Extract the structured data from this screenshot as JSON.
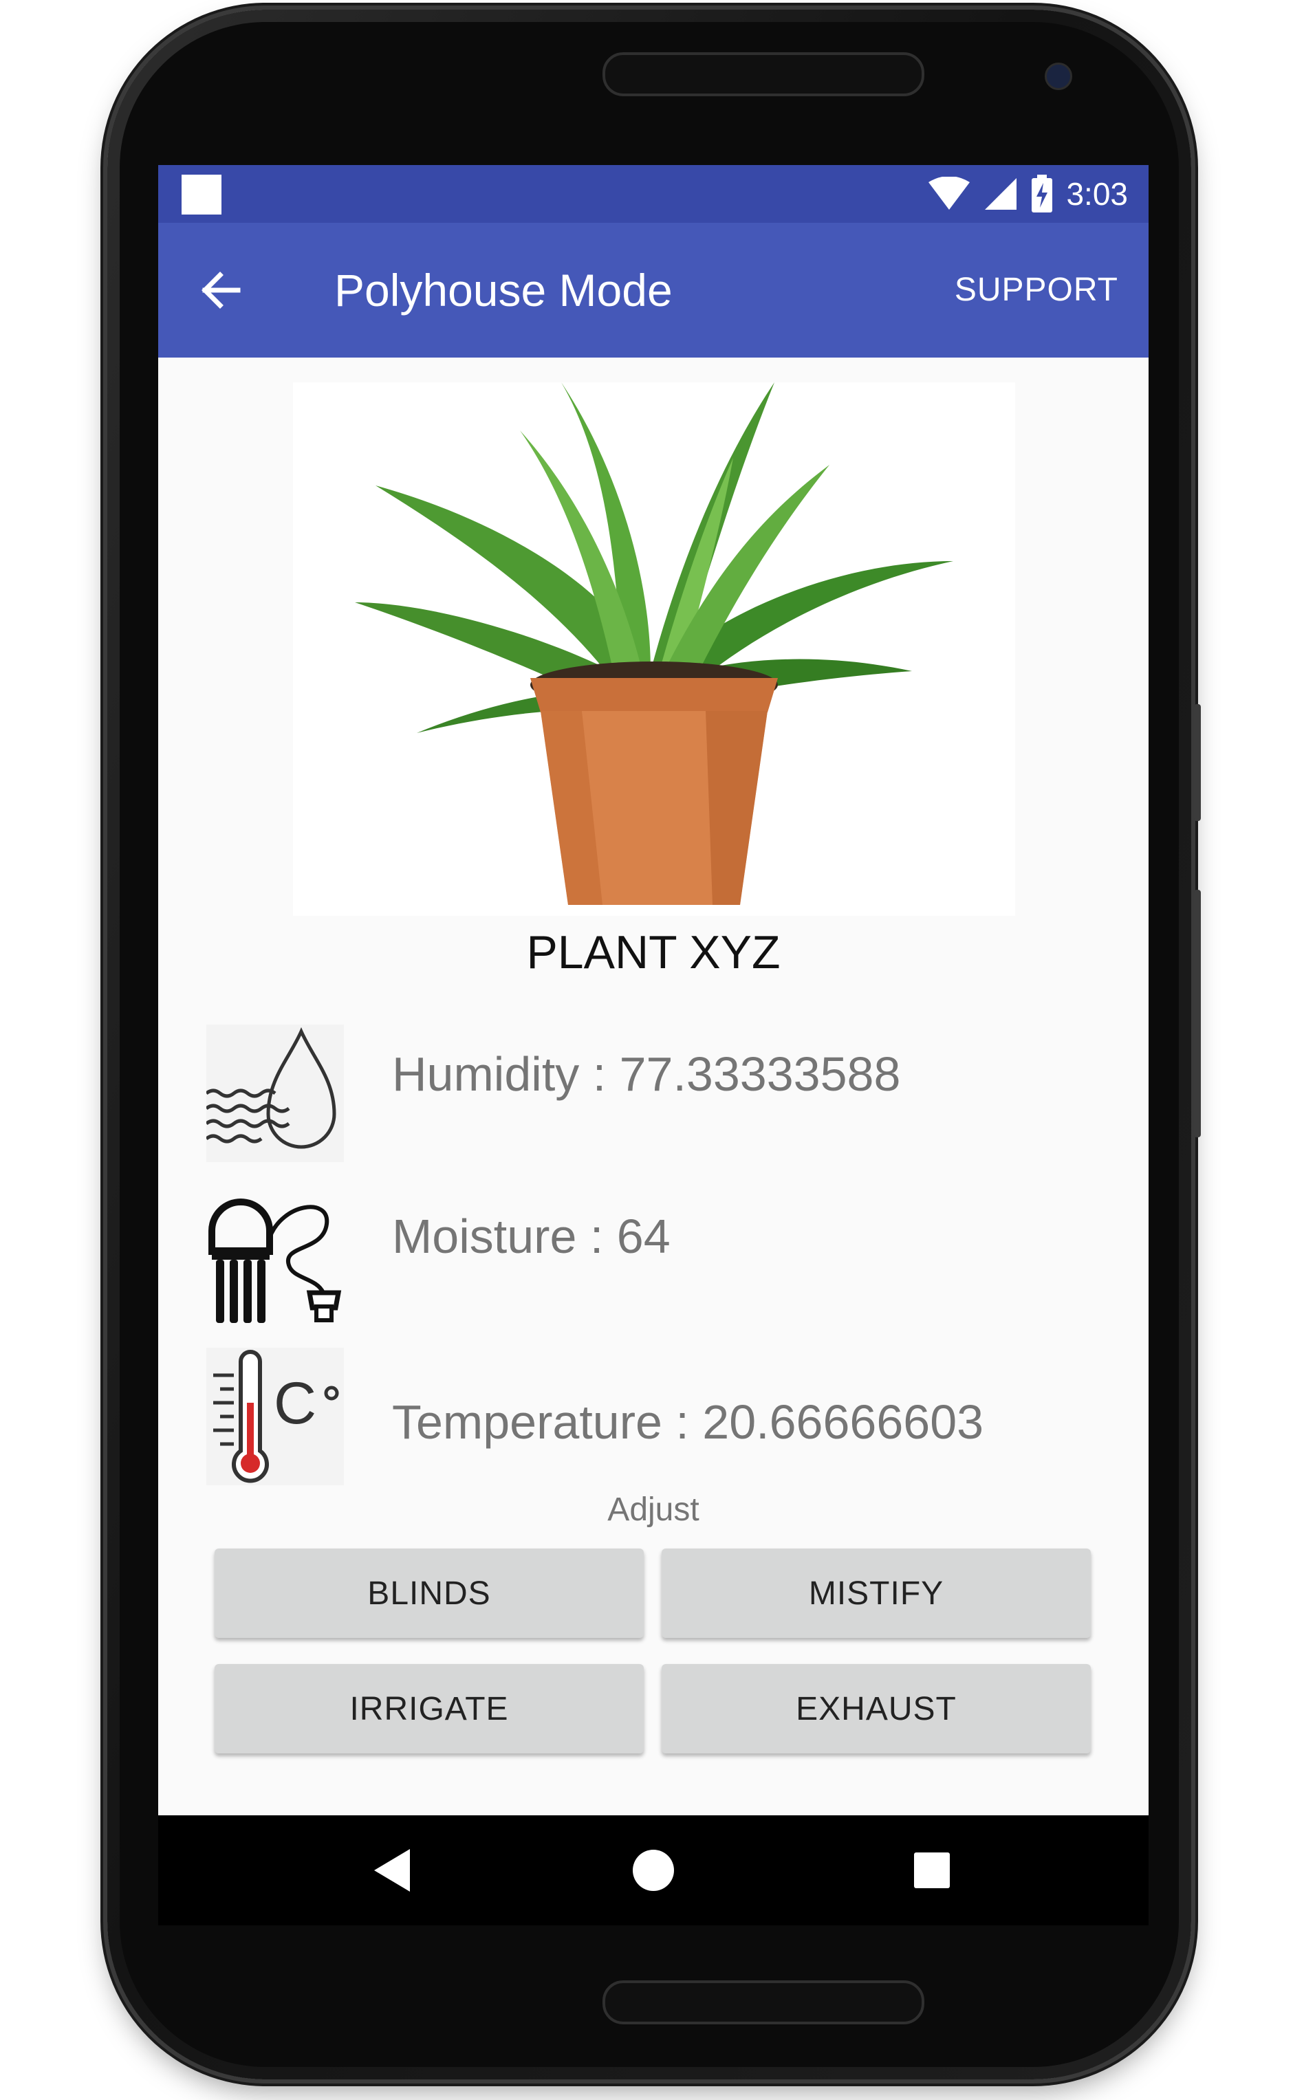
{
  "status_bar": {
    "time": "3:03",
    "icons": [
      "notification-square-icon",
      "wifi-icon",
      "signal-icon",
      "battery-charging-icon"
    ]
  },
  "app_bar": {
    "title": "Polyhouse Mode",
    "back_icon": "arrow-back-icon",
    "support_label": "SUPPORT"
  },
  "plant": {
    "name": "PLANT XYZ",
    "image": "potted-plant-image"
  },
  "sensors": {
    "humidity": {
      "text": "Humidity : 77.33333588",
      "icon": "humidity-drop-icon"
    },
    "moisture": {
      "text": "Moisture : 64",
      "icon": "soil-moisture-sensor-icon"
    },
    "temperature": {
      "text": "Temperature : 20.66666603",
      "icon": "thermometer-celsius-icon"
    }
  },
  "adjust": {
    "label": "Adjust",
    "buttons": [
      "BLINDS",
      "MISTIFY",
      "IRRIGATE",
      "EXHAUST"
    ]
  },
  "nav_bar": {
    "icons": [
      "nav-back-icon",
      "nav-home-icon",
      "nav-recents-icon"
    ]
  },
  "colors": {
    "status_bar": "#3849a8",
    "app_bar": "#4558b8",
    "button_bg": "#d6d7d7",
    "text_gray": "#757575"
  }
}
